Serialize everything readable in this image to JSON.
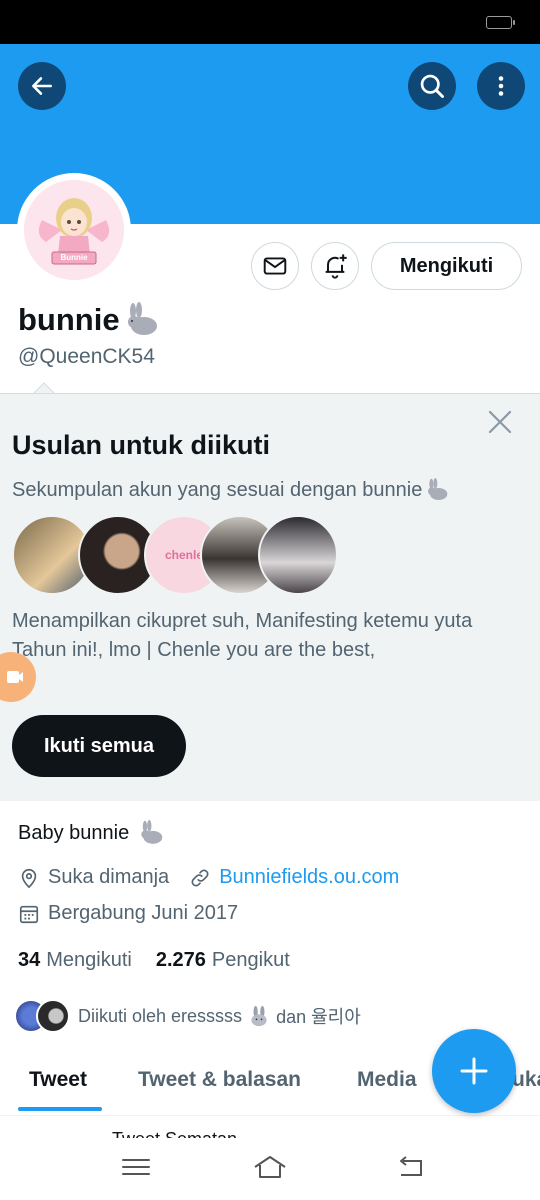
{
  "profile": {
    "display_name": "bunnie",
    "handle": "@QueenCK54",
    "avatar_label": "Bunnie",
    "follow_button": "Mengikuti",
    "bio": "Baby bunnie",
    "location": "Suka dimanja",
    "website": "Bunniefields.ou.com",
    "joined": "Bergabung Juni 2017",
    "following_count": "34",
    "following_label": "Mengikuti",
    "followers_count": "2.276",
    "followers_label": "Pengikut",
    "followed_by_prefix": "Diikuti oleh eresssss",
    "followed_by_suffix": "dan 율리아"
  },
  "suggestions": {
    "title": "Usulan untuk diikuti",
    "subtitle": "Sekumpulan akun yang sesuai dengan bunnie",
    "description": "Menampilkan cikupret suh, Manifesting ketemu yuta Tahun ini!, lmo | Chenle you are the best,",
    "avatar_text": "chenle",
    "follow_all_button": "Ikuti semua"
  },
  "tabs": [
    {
      "label": "Tweet"
    },
    {
      "label": "Tweet & balasan"
    },
    {
      "label": "Media"
    },
    {
      "label": "Suka"
    }
  ],
  "peek_text": "Tweet Sematan",
  "colors": {
    "accent": "#1d9bf0",
    "text_primary": "#0f1419",
    "text_secondary": "#536471",
    "suggestion_bg": "#eff3f4"
  }
}
